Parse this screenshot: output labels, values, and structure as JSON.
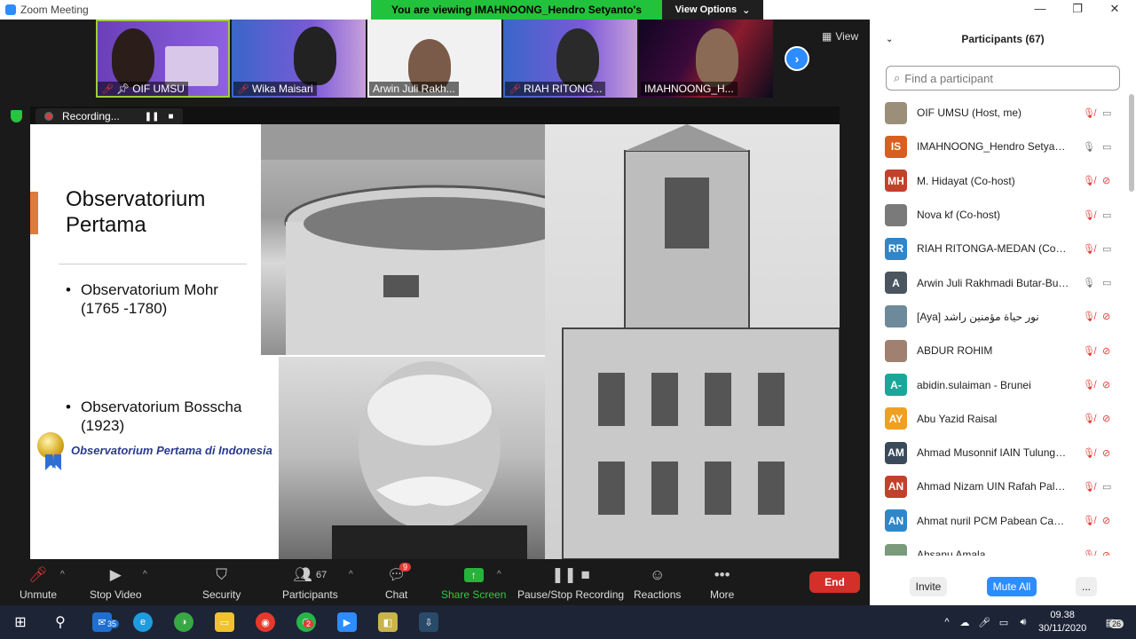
{
  "window": {
    "title": "Zoom Meeting",
    "banner": "You are viewing IMAHNOONG_Hendro Setyanto's screen",
    "view_options": "View Options",
    "view_label": "View"
  },
  "thumbnails": [
    {
      "name": "OIF UMSU",
      "muted": true,
      "pinned": true
    },
    {
      "name": "Wika Maisari",
      "muted": true
    },
    {
      "name": "Arwin Juli Rakh...",
      "muted": false
    },
    {
      "name": "RIAH RITONG...",
      "muted": true
    },
    {
      "name": "IMAHNOONG_H...",
      "muted": false
    }
  ],
  "recording": {
    "label": "Recording..."
  },
  "slide": {
    "title_line1": "Observatorium",
    "title_line2": "Pertama",
    "bullet1_line1": "Observatorium Mohr",
    "bullet1_line2": "(1765 -1780)",
    "bullet2_line1": "Observatorium Bosscha",
    "bullet2_line2": "(1923)",
    "caption": "Observatorium Pertama di Indonesia"
  },
  "toolbar": {
    "unmute": "Unmute",
    "stop_video": "Stop Video",
    "security": "Security",
    "participants": "Participants",
    "participants_count": "67",
    "chat": "Chat",
    "chat_badge": "9",
    "share_screen": "Share Screen",
    "pause_recording": "Pause/Stop Recording",
    "reactions": "Reactions",
    "more": "More",
    "end": "End"
  },
  "panel": {
    "title": "Participants (67)",
    "search_placeholder": "Find a participant",
    "invite": "Invite",
    "mute_all": "Mute All",
    "more": "...",
    "participants": [
      {
        "initials": "",
        "name": "OIF UMSU (Host, me)",
        "color": "#9c8f7a",
        "mic": "off",
        "cam": "on"
      },
      {
        "initials": "IS",
        "name": "IMAHNOONG_Hendro Setyanto",
        "color": "#d95f1e",
        "mic": "on",
        "cam": "on"
      },
      {
        "initials": "MH",
        "name": "M. Hidayat (Co-host)",
        "color": "#c2412b",
        "mic": "off",
        "cam": "off"
      },
      {
        "initials": "",
        "name": "Nova kf (Co-host)",
        "color": "#7a7a7a",
        "mic": "off",
        "cam": "on"
      },
      {
        "initials": "RR",
        "name": "RIAH RITONGA-MEDAN (Co-host)",
        "color": "#2f86c9",
        "mic": "off",
        "cam": "on"
      },
      {
        "initials": "A",
        "name": "Arwin Juli Rakhmadi Butar-Butar",
        "color": "#4a5560",
        "mic": "on",
        "cam": "on"
      },
      {
        "initials": "",
        "name": "[Aya] نور حياة مؤمنين راشد",
        "color": "#6d8a9a",
        "mic": "off",
        "cam": "off"
      },
      {
        "initials": "",
        "name": "ABDUR ROHIM",
        "color": "#a08070",
        "mic": "off",
        "cam": "off"
      },
      {
        "initials": "A-",
        "name": "abidin.sulaiman - Brunei",
        "color": "#1aa79a",
        "mic": "off",
        "cam": "off"
      },
      {
        "initials": "AY",
        "name": "Abu Yazid Raisal",
        "color": "#f0a020",
        "mic": "off",
        "cam": "off"
      },
      {
        "initials": "AM",
        "name": "Ahmad Musonnif IAIN Tulungagung",
        "color": "#3a4a5a",
        "mic": "off",
        "cam": "off"
      },
      {
        "initials": "AN",
        "name": "Ahmad Nizam UIN Rafah Palembang",
        "color": "#c2412b",
        "mic": "off",
        "cam": "on"
      },
      {
        "initials": "AN",
        "name": "Ahmat nuril PCM Pabean Cantian",
        "color": "#2f86c9",
        "mic": "off",
        "cam": "off"
      },
      {
        "initials": "",
        "name": "Ahsanu Amala",
        "color": "#7a9a7a",
        "mic": "off",
        "cam": "off"
      }
    ]
  },
  "taskbar": {
    "mail_badge": "35",
    "whatsapp_badge": "2",
    "time": "09.38",
    "date": "30/11/2020",
    "notif_count": "26"
  }
}
